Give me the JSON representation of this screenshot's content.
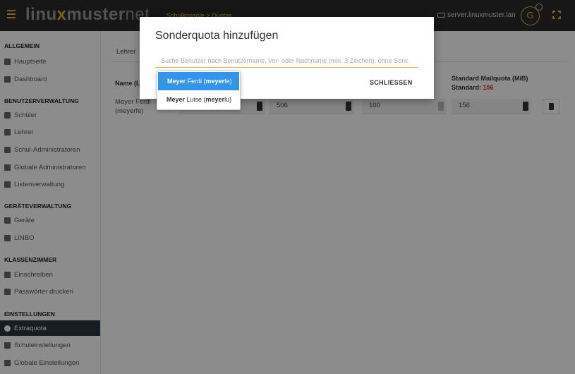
{
  "topbar": {
    "logo_a": "linu",
    "logo_x": "x",
    "logo_b": "muster",
    "logo_c": "net",
    "breadcrumb_root": "Schulkonsole",
    "breadcrumb_sep": ">",
    "breadcrumb_page": "Quotas",
    "server": "server.linuxmuster.lan",
    "avatar_initial": "G"
  },
  "sidebar": {
    "sections": [
      {
        "title": "ALLGEMEIN",
        "items": [
          {
            "label": "Hauptseite",
            "icon": "home-icon"
          },
          {
            "label": "Dashboard",
            "icon": "chart-icon"
          }
        ]
      },
      {
        "title": "BENUTZERVERWALTUNG",
        "items": [
          {
            "label": "Schüler",
            "icon": "student-icon"
          },
          {
            "label": "Lehrer",
            "icon": "teacher-icon"
          },
          {
            "label": "Schul-Administratoren",
            "icon": "admin-icon"
          },
          {
            "label": "Globale Administratoren",
            "icon": "global-admin-icon"
          },
          {
            "label": "Listenverwaltung",
            "icon": "list-icon"
          }
        ]
      },
      {
        "title": "GERÄTEVERWALTUNG",
        "items": [
          {
            "label": "Geräte",
            "icon": "laptop-icon"
          },
          {
            "label": "LINBO",
            "icon": "linbo-icon"
          }
        ]
      },
      {
        "title": "KLASSENZIMMER",
        "items": [
          {
            "label": "Einschreiben",
            "icon": "edit-icon"
          },
          {
            "label": "Passwörter drucken",
            "icon": "key-icon"
          }
        ]
      },
      {
        "title": "EINSTELLUNGEN",
        "items": [
          {
            "label": "Extraquota",
            "icon": "pie-icon",
            "active": true
          },
          {
            "label": "Schuleinstellungen",
            "icon": "sliders-icon"
          },
          {
            "label": "Globale Einstellungen",
            "icon": "gears-icon"
          }
        ]
      }
    ]
  },
  "main": {
    "tab": "Lehrer",
    "col_name": "Name (Lo",
    "col_mailquota": "Standard Mailquota (MiB)",
    "col_mailquota_std_label": "Standard:",
    "col_mailquota_std_value": "156",
    "row": {
      "name_line1": "Meyer Ferdi",
      "name_line2": "(meyerfe)",
      "values": [
        "",
        "506",
        "100",
        "156"
      ]
    }
  },
  "modal": {
    "title": "Sonderquota hinzufügen",
    "search_placeholder": "Suche Benutzer nach Benutzername, Vor- oder Nachname (min. 3 Zeichen), ohne Sonc",
    "close_label": "SCHLIESSEN"
  },
  "dropdown": {
    "items": [
      {
        "bold1": "Meyer",
        "rest1": " Ferdi (",
        "bold2": "meyer",
        "rest2": "fe)",
        "highlighted": true
      },
      {
        "bold1": "Meyer",
        "rest1": " Luise (",
        "bold2": "meyer",
        "rest2": "lu)",
        "highlighted": false
      }
    ]
  },
  "colors": {
    "accent": "#e2b13c",
    "topbar": "#2b2b2b",
    "active_item": "#2c3440",
    "highlight": "#3394ea",
    "quota_red": "#c9302c"
  }
}
